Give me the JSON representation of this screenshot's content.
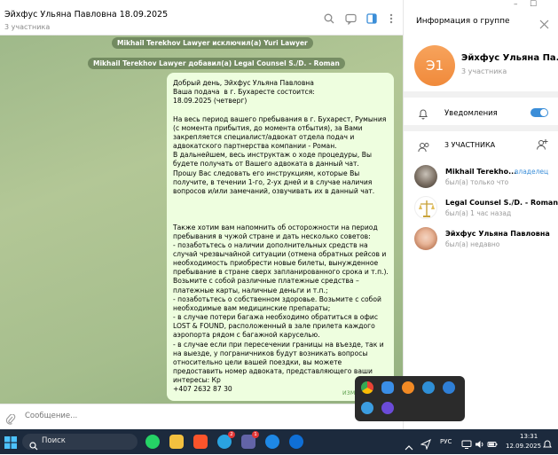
{
  "window": {
    "min": "–",
    "max": "☐"
  },
  "chat": {
    "title": "Эйхфус Ульяна Павловна 18.09.2025",
    "subtitle": "3 участника",
    "service_1": "Mikhail Terekhov Lawyer исключил(а) Yuri Lawyer",
    "service_2": "Mikhail Terekhov Lawyer добавил(а) Legal Counsel S./D. - Roman",
    "message": "Добрый день, Эйхфус Ульяна Павловна\nВаша подача  в г. Бухаресте состоится:\n18.09.2025 (четверг)\n\nНа весь период вашего пребывания в г. Бухарест, Румыния (с момента прибытия, до момента отбытия), за Вами закрепляется специалист/адвокат отдела подач и адвокатского партнерства компании - Роман.\nВ дальнейшем, весь инструктаж о ходе процедуры, Вы будете получать от Вашего адвоката в данный чат.\nПрошу Вас следовать его инструкциям, которые Вы получите, в течении 1-го, 2-ух дней и в случае наличия вопросов и/или замечаний, озвучивать их в данный чат.\n\n\n\nТакже хотим вам напомнить об осторожности на период пребывания в чужой стране и дать несколько советов:\n- позаботьтесь о наличии дополнительных средств на случай чрезвычайной ситуации (отмена обратных рейсов и необходимость приобрести новые билеты, вынужденное пребывание в стране сверх запланированного срока и т.п.). Возьмите с собой различные платежные средства – платежные карты, наличные деньги и т.п.;\n- позаботьтесь о собственном здоровье. Возьмите с собой необходимые вам медицинские препараты;\n- в случае потери багажа необходимо обратиться в офис LOST & FOUND, расположенный в зале прилета каждого аэропорта рядом с багажной каруселью.\n- в случае если при пересечении границы на въезде, так и на выезде, у пограничников будут возникать вопросы относительно цели вашей поездки, вы можете предоставить номер адвоката, представляющего ваши интересы: Кр\n+407 2632 87 30",
    "edited_label": "изменено",
    "composer_placeholder": "Сообщение..."
  },
  "panel": {
    "title": "Информация о группе",
    "avatar_initials": "Э1",
    "group_name": "Эйхфус Ульяна Па...",
    "group_members": "3 участника",
    "notifications_label": "Уведомления",
    "members_header": "3 УЧАСТНИКА",
    "members": [
      {
        "name": "Mikhail Terekho...",
        "role": "владелец",
        "status": "был(а) только что"
      },
      {
        "name": "Legal Counsel S./D. - Roman",
        "status": "был(а) 1 час назад"
      },
      {
        "name": "Эйхфус Ульяна Павловна",
        "status": "был(а) недавно"
      }
    ]
  },
  "taskbar": {
    "search_label": "Поиск",
    "badge_1": "2",
    "badge_2": "1",
    "lang": "РУС",
    "time": "13:31",
    "date": "12.09.2025"
  },
  "colors": {
    "accent": "#3b8ed8",
    "bubble": "#eefedf",
    "taskbar": "#1c2a3d"
  }
}
